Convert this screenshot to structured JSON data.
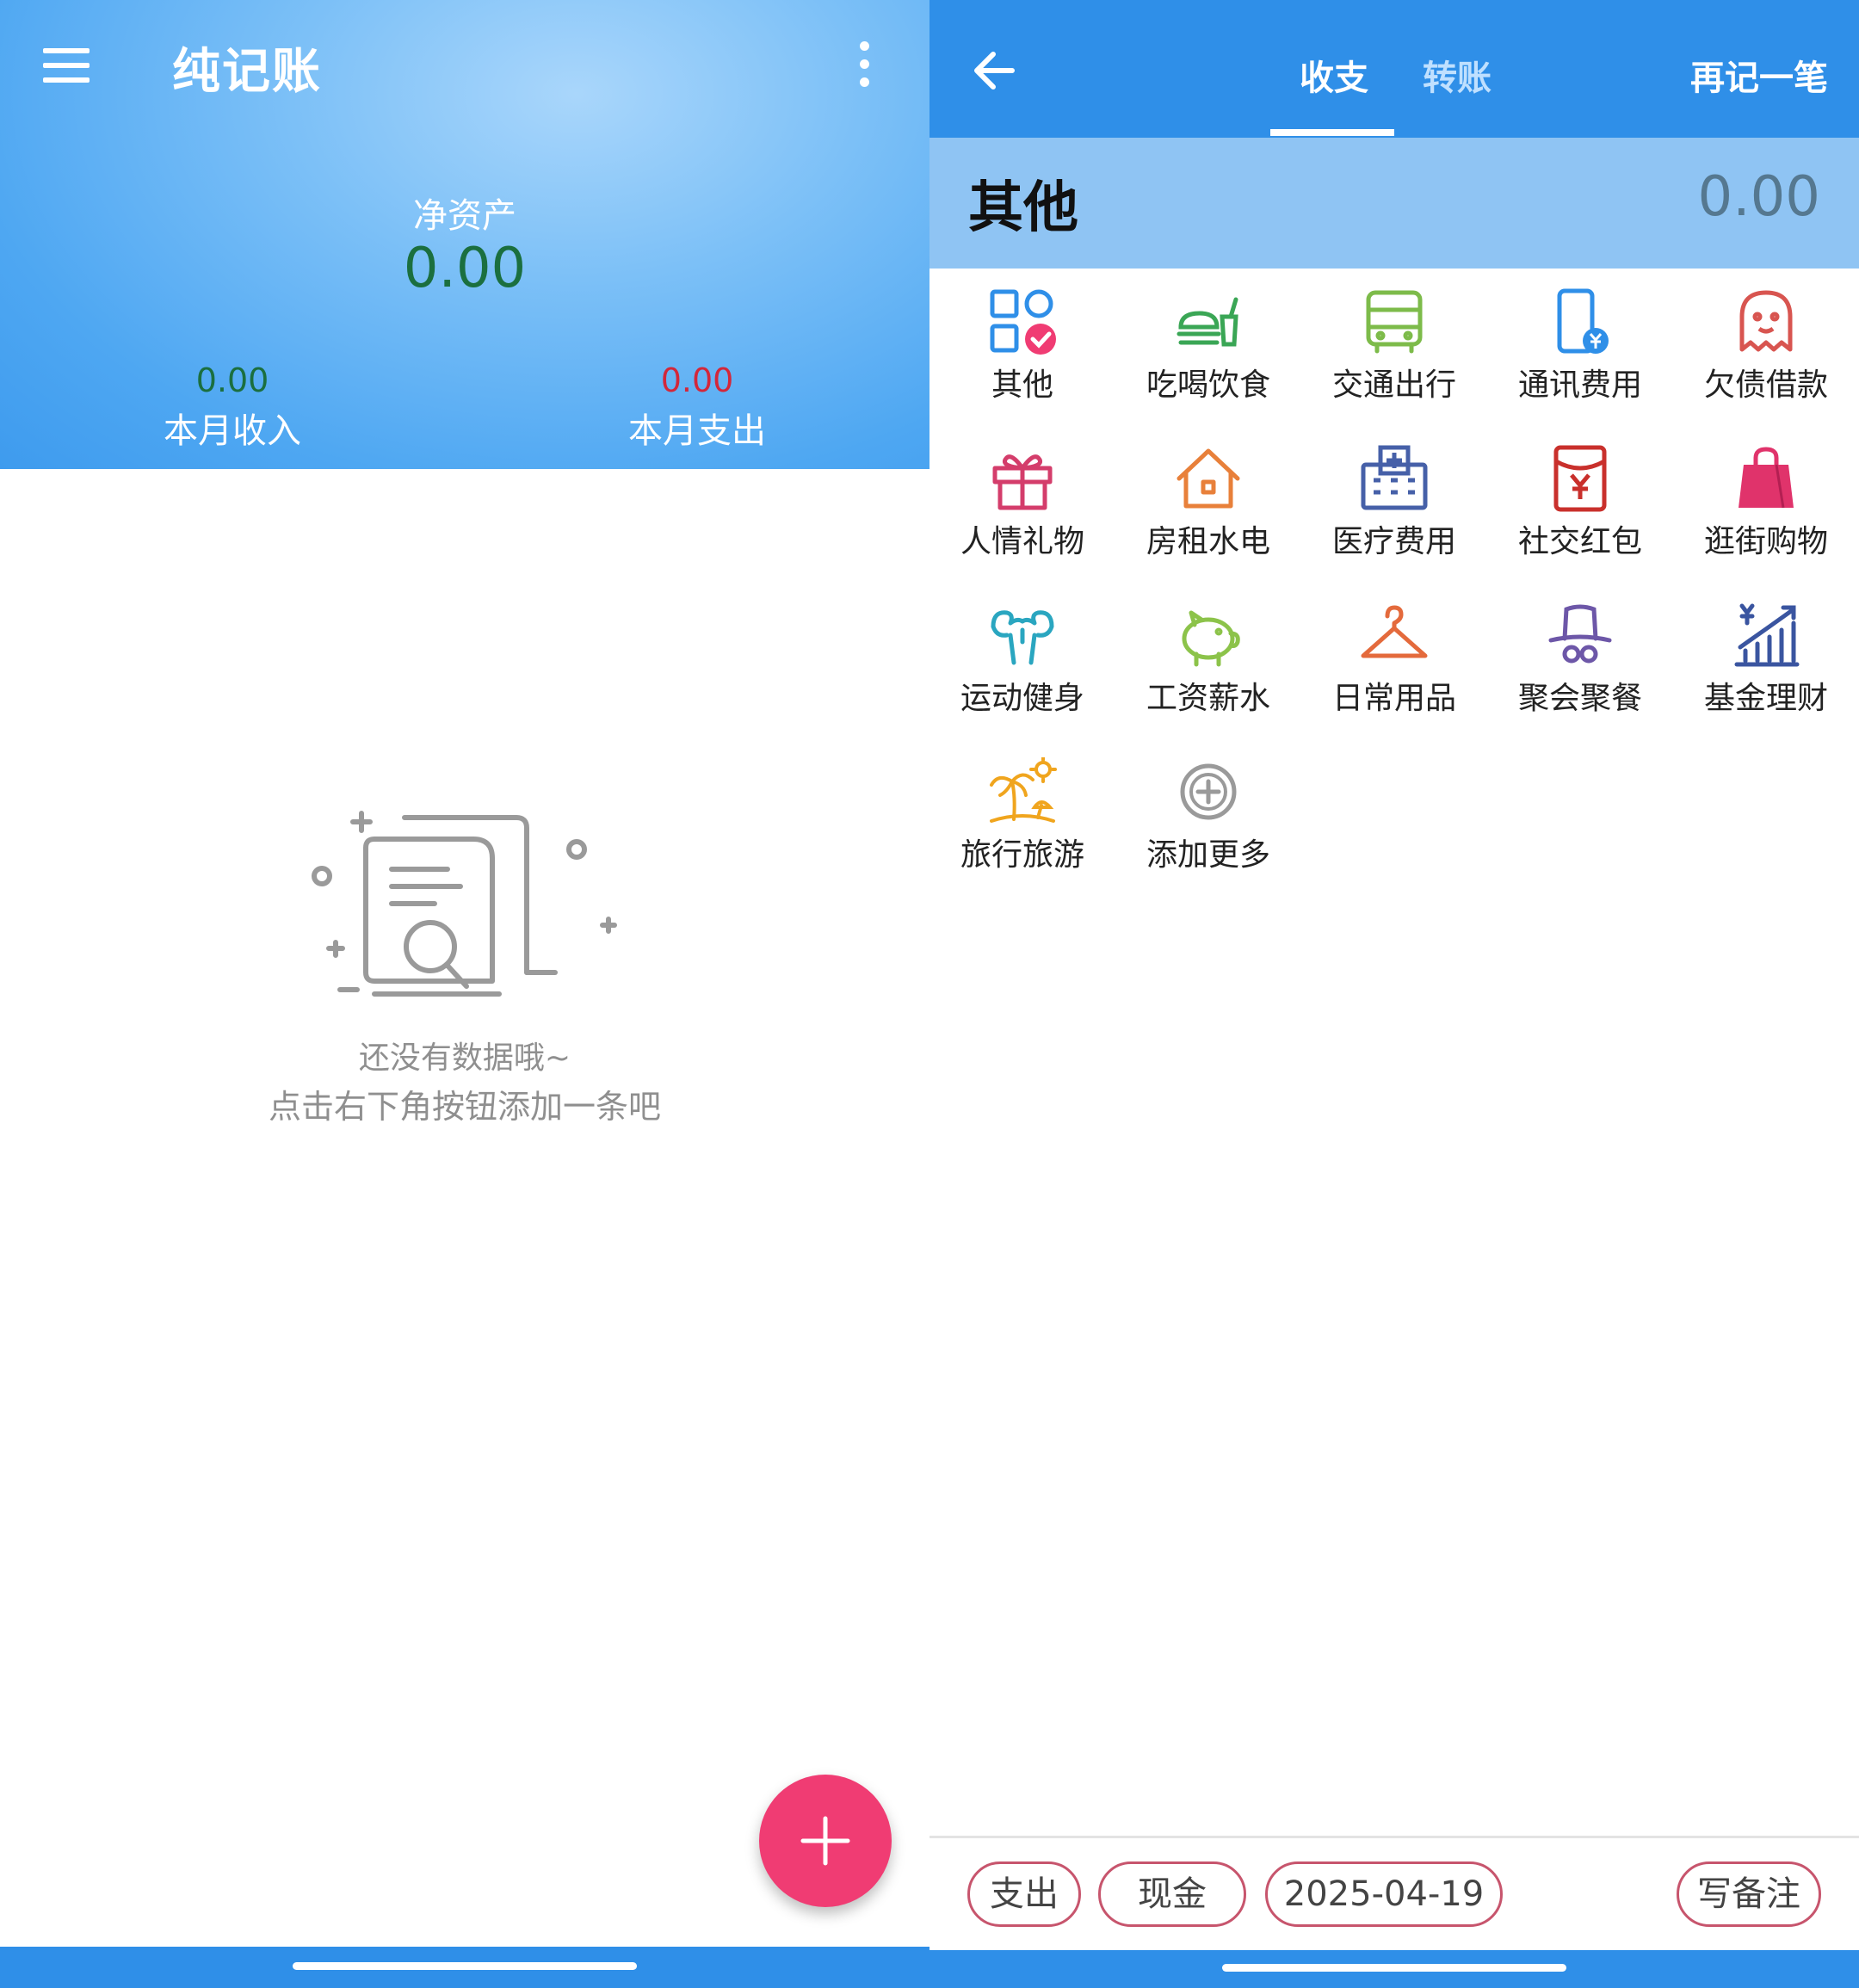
{
  "left": {
    "app_title": "纯记账",
    "net_assets_label": "净资产",
    "net_assets_value": "0.00",
    "month_income_value": "0.00",
    "month_income_label": "本月收入",
    "month_expense_value": "0.00",
    "month_expense_label": "本月支出",
    "empty_line1": "还没有数据哦~",
    "empty_line2": "点击右下角按钮添加一条吧",
    "icons": {
      "menu": "hamburger-menu-icon",
      "more": "more-vertical-icon",
      "fab": "plus-icon",
      "empty": "empty-document-search-icon"
    },
    "colors": {
      "header": "#4ea7f2",
      "income": "#1b6f3f",
      "expense": "#d3273a",
      "fab": "#f03c73"
    }
  },
  "right": {
    "tabs": [
      "收支",
      "转账"
    ],
    "active_tab": "收支",
    "again_label": "再记一笔",
    "selected_category": "其他",
    "amount": "0.00",
    "categories": [
      {
        "label": "其他",
        "icon": "other-grid-check-icon",
        "color": "#2f8fe8"
      },
      {
        "label": "吃喝饮食",
        "icon": "burger-drink-icon",
        "color": "#3aa655"
      },
      {
        "label": "交通出行",
        "icon": "bus-icon",
        "color": "#7dbb4a"
      },
      {
        "label": "通讯费用",
        "icon": "phone-yen-icon",
        "color": "#2f8fe8"
      },
      {
        "label": "欠债借款",
        "icon": "ghost-icon",
        "color": "#d85550"
      },
      {
        "label": "人情礼物",
        "icon": "gift-icon",
        "color": "#d43d6b"
      },
      {
        "label": "房租水电",
        "icon": "house-icon",
        "color": "#e8803a"
      },
      {
        "label": "医疗费用",
        "icon": "hospital-icon",
        "color": "#4660a8"
      },
      {
        "label": "社交红包",
        "icon": "red-envelope-icon",
        "color": "#c9302c"
      },
      {
        "label": "逛街购物",
        "icon": "shopping-bag-icon",
        "color": "#e0336b"
      },
      {
        "label": "运动健身",
        "icon": "muscle-icon",
        "color": "#2aa6c0"
      },
      {
        "label": "工资薪水",
        "icon": "piggy-bank-icon",
        "color": "#8cc34a"
      },
      {
        "label": "日常用品",
        "icon": "hanger-icon",
        "color": "#e46a3c"
      },
      {
        "label": "聚会聚餐",
        "icon": "spy-hat-icon",
        "color": "#6d57a8"
      },
      {
        "label": "基金理财",
        "icon": "fund-chart-icon",
        "color": "#3a55a0"
      },
      {
        "label": "旅行旅游",
        "icon": "palm-beach-icon",
        "color": "#f0a51e"
      },
      {
        "label": "添加更多",
        "icon": "add-circle-icon",
        "color": "#9a9a9a"
      }
    ],
    "chips": {
      "type": "支出",
      "account": "现金",
      "date": "2025-04-19",
      "note": "写备注"
    },
    "icons": {
      "back": "arrow-left-icon"
    },
    "colors": {
      "toolbar": "#2f8fe8",
      "selected_bar": "#8fc4f3",
      "chip_border": "#c7556d"
    }
  }
}
